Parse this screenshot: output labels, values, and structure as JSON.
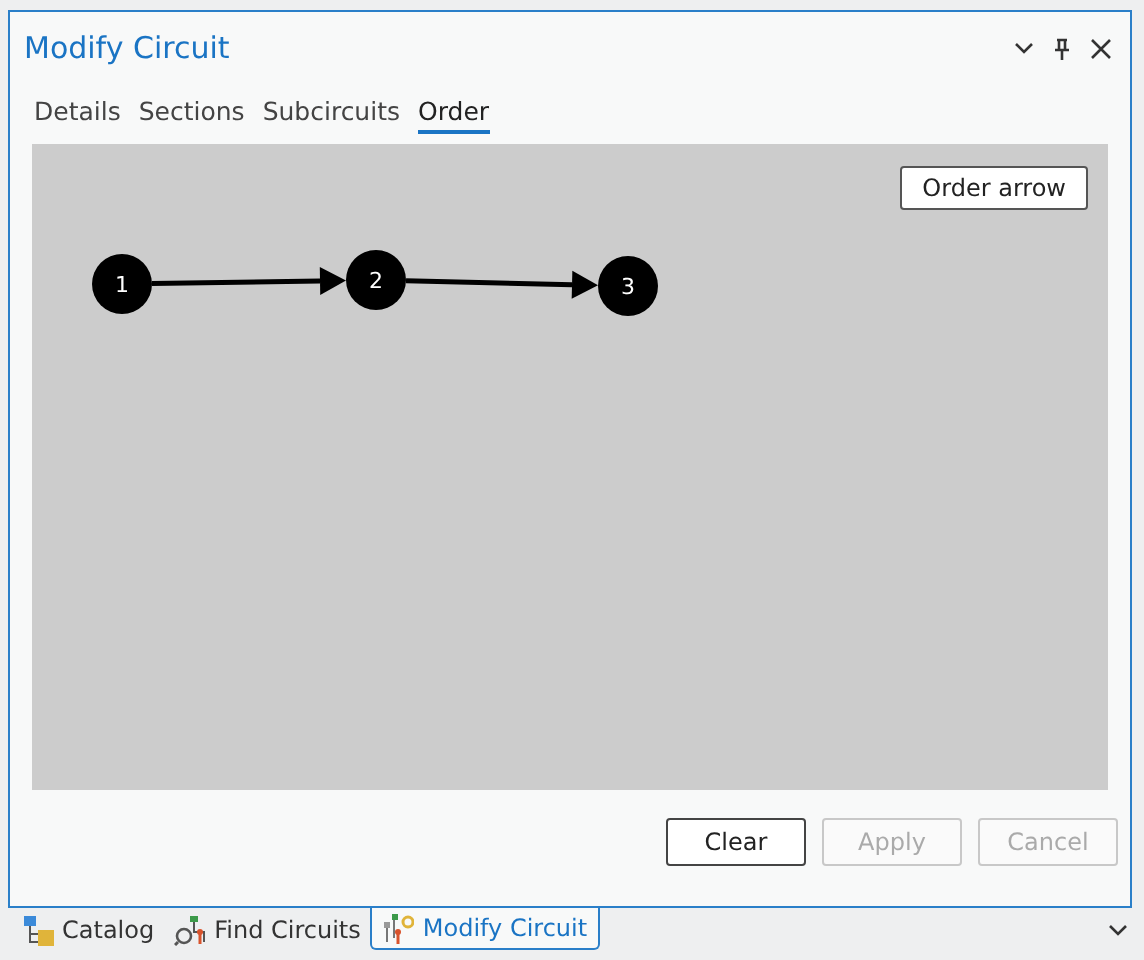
{
  "window": {
    "title": "Modify Circuit"
  },
  "tabs": [
    {
      "label": "Details",
      "selected": false
    },
    {
      "label": "Sections",
      "selected": false
    },
    {
      "label": "Subcircuits",
      "selected": false
    },
    {
      "label": "Order",
      "selected": true
    }
  ],
  "canvas": {
    "order_button": "Order arrow",
    "nodes": [
      {
        "label": "1"
      },
      {
        "label": "2"
      },
      {
        "label": "3"
      }
    ]
  },
  "buttons": [
    {
      "label": "Clear",
      "disabled": false
    },
    {
      "label": "Apply",
      "disabled": true
    },
    {
      "label": "Cancel",
      "disabled": true
    }
  ],
  "dock_tabs": [
    {
      "label": "Catalog",
      "selected": false,
      "kind": "catalog"
    },
    {
      "label": "Find Circuits",
      "selected": false,
      "kind": "find"
    },
    {
      "label": "Modify Circuit",
      "selected": true,
      "kind": "modify"
    }
  ]
}
